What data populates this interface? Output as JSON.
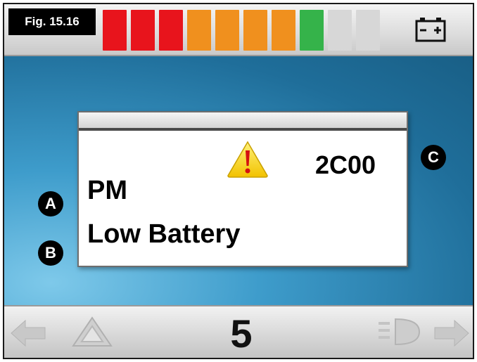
{
  "figure": {
    "label": "Fig. 15.16"
  },
  "battery_gauge": {
    "segments": [
      {
        "state": "red"
      },
      {
        "state": "red"
      },
      {
        "state": "red"
      },
      {
        "state": "orange"
      },
      {
        "state": "orange"
      },
      {
        "state": "orange"
      },
      {
        "state": "orange"
      },
      {
        "state": "green"
      },
      {
        "state": "empty"
      },
      {
        "state": "empty"
      }
    ],
    "colors": {
      "red": "#e8141c",
      "orange": "#f0901e",
      "green": "#35b34a",
      "empty": "#d7d7d7"
    },
    "icon": "battery-icon"
  },
  "dialog": {
    "icon": "warning-icon",
    "code": "2C00",
    "module": "PM",
    "message": "Low Battery"
  },
  "callouts": {
    "a": "A",
    "b": "B",
    "c": "C"
  },
  "bottom_bar": {
    "speed_setting": "5",
    "left_icons": [
      "arrow-left-icon",
      "hazard-icon"
    ],
    "right_icons": [
      "lights-icon",
      "arrow-right-icon"
    ]
  }
}
